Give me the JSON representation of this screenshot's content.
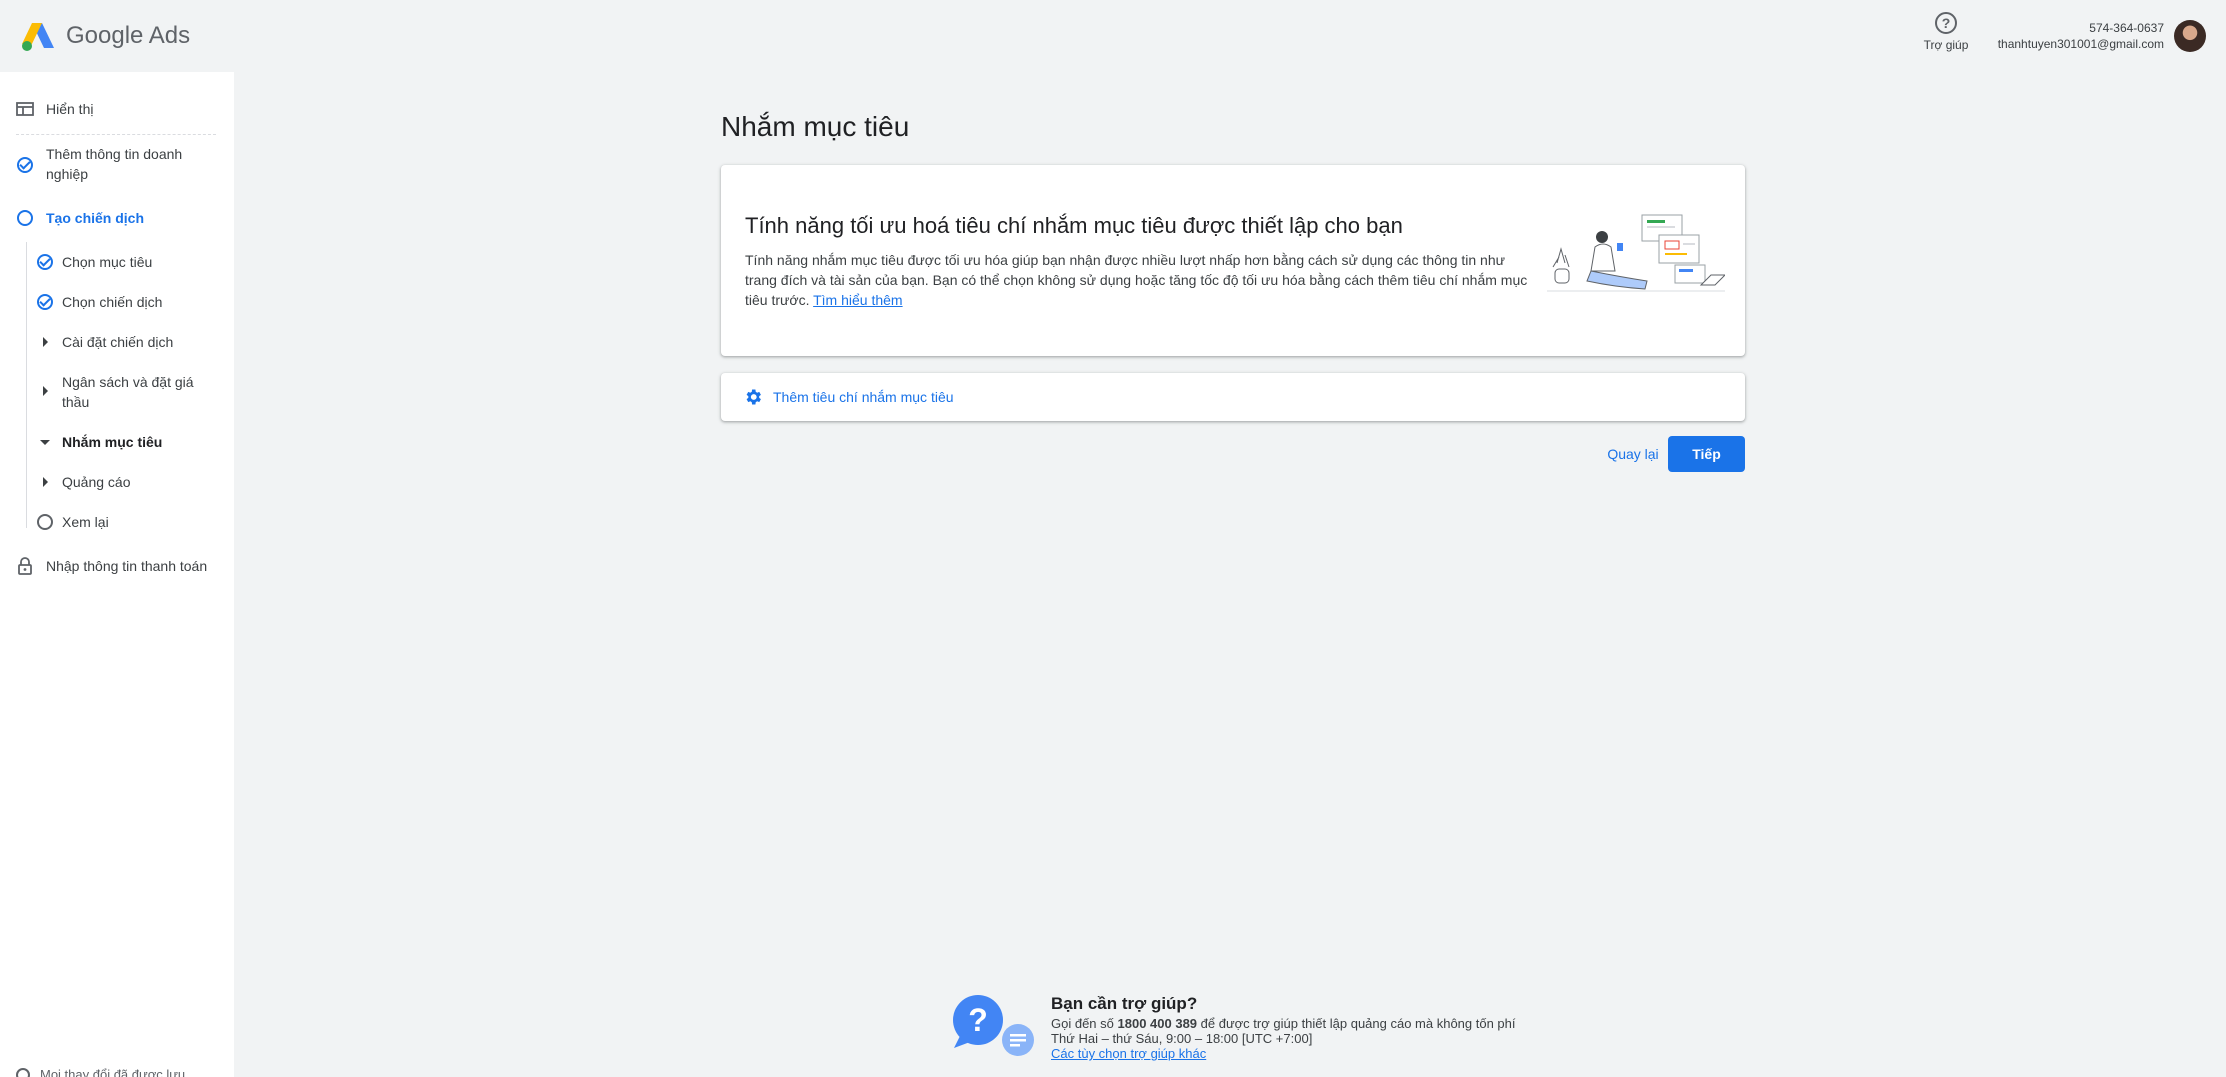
{
  "app": {
    "brand": "Google Ads"
  },
  "header": {
    "help_label": "Trợ giúp",
    "account_id": "574-364-0637",
    "account_email": "thanhtuyen301001@gmail.com"
  },
  "sidebar": {
    "items": [
      {
        "label": "Hiển thị",
        "state": "view"
      },
      {
        "label": "Thêm thông tin doanh nghiệp",
        "state": "done"
      },
      {
        "label": "Tạo chiến dịch",
        "state": "active"
      },
      {
        "label": "Chọn mục tiêu",
        "state": "done"
      },
      {
        "label": "Chọn chiến dịch",
        "state": "done"
      },
      {
        "label": "Cài đặt chiến dịch",
        "state": "collapsed"
      },
      {
        "label": "Ngân sách và đặt giá thầu",
        "state": "collapsed"
      },
      {
        "label": "Nhắm mục tiêu",
        "state": "expanded"
      },
      {
        "label": "Quảng cáo",
        "state": "collapsed"
      },
      {
        "label": "Xem lại",
        "state": "pending"
      },
      {
        "label": "Nhập thông tin thanh toán",
        "state": "locked"
      }
    ],
    "saved_status": "Mọi thay đổi đã được lưu"
  },
  "main": {
    "title": "Nhắm mục tiêu",
    "card": {
      "title": "Tính năng tối ưu hoá tiêu chí nhắm mục tiêu được thiết lập cho bạn",
      "description": "Tính năng nhắm mục tiêu được tối ưu hóa giúp bạn nhận được nhiều lượt nhấp hơn bằng cách sử dụng các thông tin như trang đích và tài sản của bạn. Bạn có thể chọn không sử dụng hoặc tăng tốc độ tối ưu hóa bằng cách thêm tiêu chí nhắm mục tiêu trước.",
      "learn_more": "Tìm hiểu thêm"
    },
    "add_criteria_label": "Thêm tiêu chí nhắm mục tiêu",
    "back_button": "Quay lại",
    "next_button": "Tiếp"
  },
  "footer_help": {
    "title": "Bạn cần trợ giúp?",
    "call_prefix": "Gọi đến số",
    "phone": "1800 400 389",
    "call_suffix": "để được trợ giúp thiết lập quảng cáo mà không tốn phí",
    "hours": "Thứ Hai – thứ Sáu, 9:00 – 18:00 [UTC +7:00]",
    "other_options": "Các tùy chọn trợ giúp khác"
  },
  "colors": {
    "accent": "#1a73e8",
    "background": "#f1f3f4",
    "text": "#202124"
  }
}
